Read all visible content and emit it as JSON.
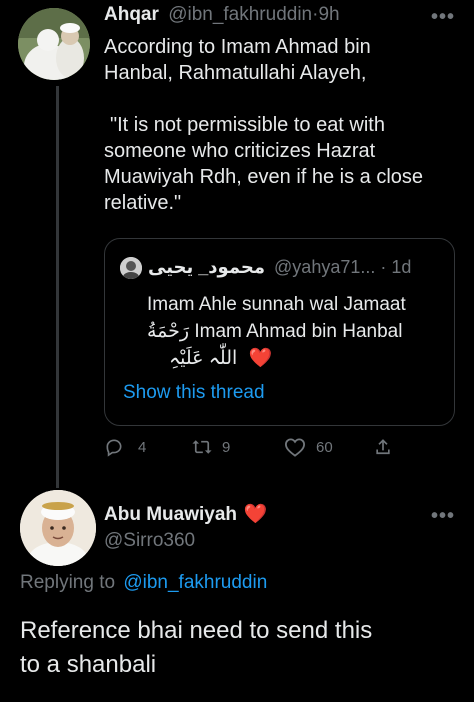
{
  "tweet": {
    "author_name": "Ahqar",
    "handle": "@ibn_fakhruddin",
    "dot": "·",
    "time": "9h",
    "more": "•••",
    "text_line1": "According to Imam Ahmad bin",
    "text_line2": "Hanbal, Rahmatullahi Alayeh,",
    "quote_line1": "\"It is not permissible to eat with",
    "quote_line2": "someone who criticizes Hazrat",
    "quote_line3": "Muawiyah Rdh, even if he is a close",
    "quote_line4": "relative.\""
  },
  "quoted": {
    "author_name": "محمود_ يحيى",
    "handle": "@yahya71...",
    "dot": "·",
    "time": "1d",
    "line1": "Imam Ahle sunnah wal Jamaat",
    "line2_arabic": "رَحْمَةُ",
    "line2_text": "Imam Ahmad bin Hanbal",
    "line3_arabic": "اللّٰہ عَلَیْہِ",
    "heart": "❤️",
    "show_thread": "Show this thread"
  },
  "actions": {
    "replies": "4",
    "retweets": "9",
    "likes": "60"
  },
  "reply": {
    "author_name": "Abu Muawiyah",
    "heart": "❤️",
    "handle": "@Sirro360",
    "more": "•••",
    "replying_prefix": "Replying to",
    "replying_to": "@ibn_fakhruddin",
    "text_line1": "Reference bhai need to send this",
    "text_line2": "to a shanbali"
  },
  "colors": {
    "background": "#000000",
    "text": "#e7e9ea",
    "muted": "#71767b",
    "link": "#1d9bf0",
    "border": "#333639",
    "heart": "#f4212e"
  }
}
